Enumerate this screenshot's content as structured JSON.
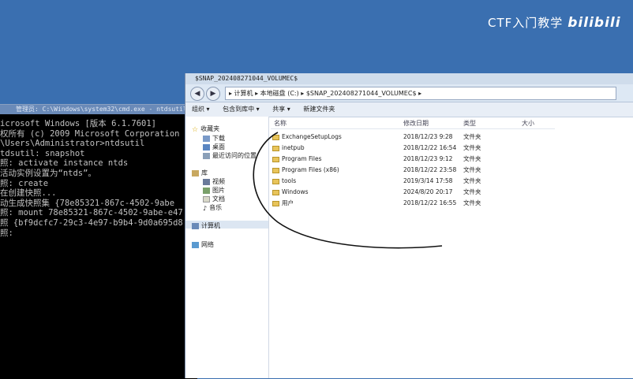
{
  "watermark": {
    "text": "CTF入门教学",
    "logo": "bilibili"
  },
  "cmd": {
    "title": "管理员: C:\\Windows\\system32\\cmd.exe - ntdsutil",
    "lines": [
      "icrosoft Windows [版本 6.1.7601]",
      "权所有 (c) 2009 Microsoft Corporation",
      "",
      "\\Users\\Administrator>ntdsutil",
      "tdsutil: snapshot",
      "照: activate instance ntds",
      "活动实例设置为“ntds”。",
      "照: create",
      "在创建快照...",
      "动生成快照集 {78e85321-867c-4502-9abe",
      "照: mount 78e85321-867c-4502-9abe-e47",
      "照 {bf9dcfc7-29c3-4e97-b9b4-9d0a695d8",
      "照:"
    ]
  },
  "explorer": {
    "title": "$SNAP_202408271044_VOLUMEC$",
    "address": "▸ 计算机 ▸ 本地磁盘 (C:) ▸ $SNAP_202408271044_VOLUMEC$ ▸",
    "toolbar": {
      "organize": "组织 ▾",
      "include": "包含到库中 ▾",
      "share": "共享 ▾",
      "newfolder": "新建文件夹"
    },
    "nav": {
      "favorites": "收藏夹",
      "downloads": "下载",
      "desktop": "桌面",
      "recent": "最近访问的位置",
      "libraries": "库",
      "videos": "视频",
      "pictures": "图片",
      "documents": "文档",
      "music": "音乐",
      "computer": "计算机",
      "network": "网络"
    },
    "columns": {
      "name": "名称",
      "date": "修改日期",
      "type": "类型",
      "size": "大小"
    },
    "files": [
      {
        "name": "ExchangeSetupLogs",
        "date": "2018/12/23 9:28",
        "type": "文件夹"
      },
      {
        "name": "inetpub",
        "date": "2018/12/22 16:54",
        "type": "文件夹"
      },
      {
        "name": "Program Files",
        "date": "2018/12/23 9:12",
        "type": "文件夹"
      },
      {
        "name": "Program Files (x86)",
        "date": "2018/12/22 23:58",
        "type": "文件夹"
      },
      {
        "name": "tools",
        "date": "2019/3/14 17:58",
        "type": "文件夹"
      },
      {
        "name": "Windows",
        "date": "2024/8/20 20:17",
        "type": "文件夹"
      },
      {
        "name": "用户",
        "date": "2018/12/22 16:55",
        "type": "文件夹"
      }
    ]
  }
}
